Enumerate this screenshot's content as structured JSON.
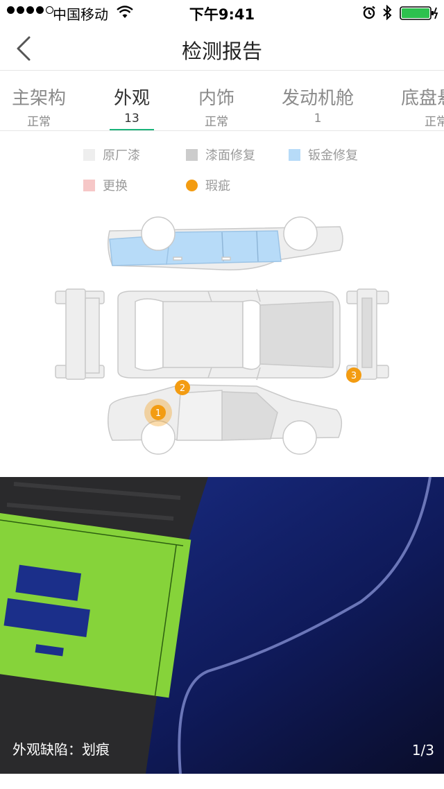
{
  "status_bar": {
    "carrier": "中国移动",
    "time": "下午9:41"
  },
  "nav": {
    "title": "检测报告"
  },
  "tabs": [
    {
      "label": "主架构",
      "sub": "正常"
    },
    {
      "label": "外观",
      "sub": "13"
    },
    {
      "label": "内饰",
      "sub": "正常"
    },
    {
      "label": "发动机舱",
      "sub": "1"
    },
    {
      "label": "底盘悬",
      "sub": "正常"
    }
  ],
  "legend": {
    "original_paint": "原厂漆",
    "paint_repair": "漆面修复",
    "sheet_metal_repair": "钣金修复",
    "replaced": "更换",
    "blemish": "瑕疵"
  },
  "markers": [
    "1",
    "2",
    "3"
  ],
  "photo": {
    "caption": "外观缺陷：划痕",
    "counter": "1/3"
  },
  "colors": {
    "accent_green": "#19b37a",
    "original_paint": "#eeeeee",
    "paint_repair": "#cccccc",
    "sheet_metal_repair": "#b7dbf8",
    "replaced": "#f6c7c7",
    "blemish": "#f39c12"
  }
}
